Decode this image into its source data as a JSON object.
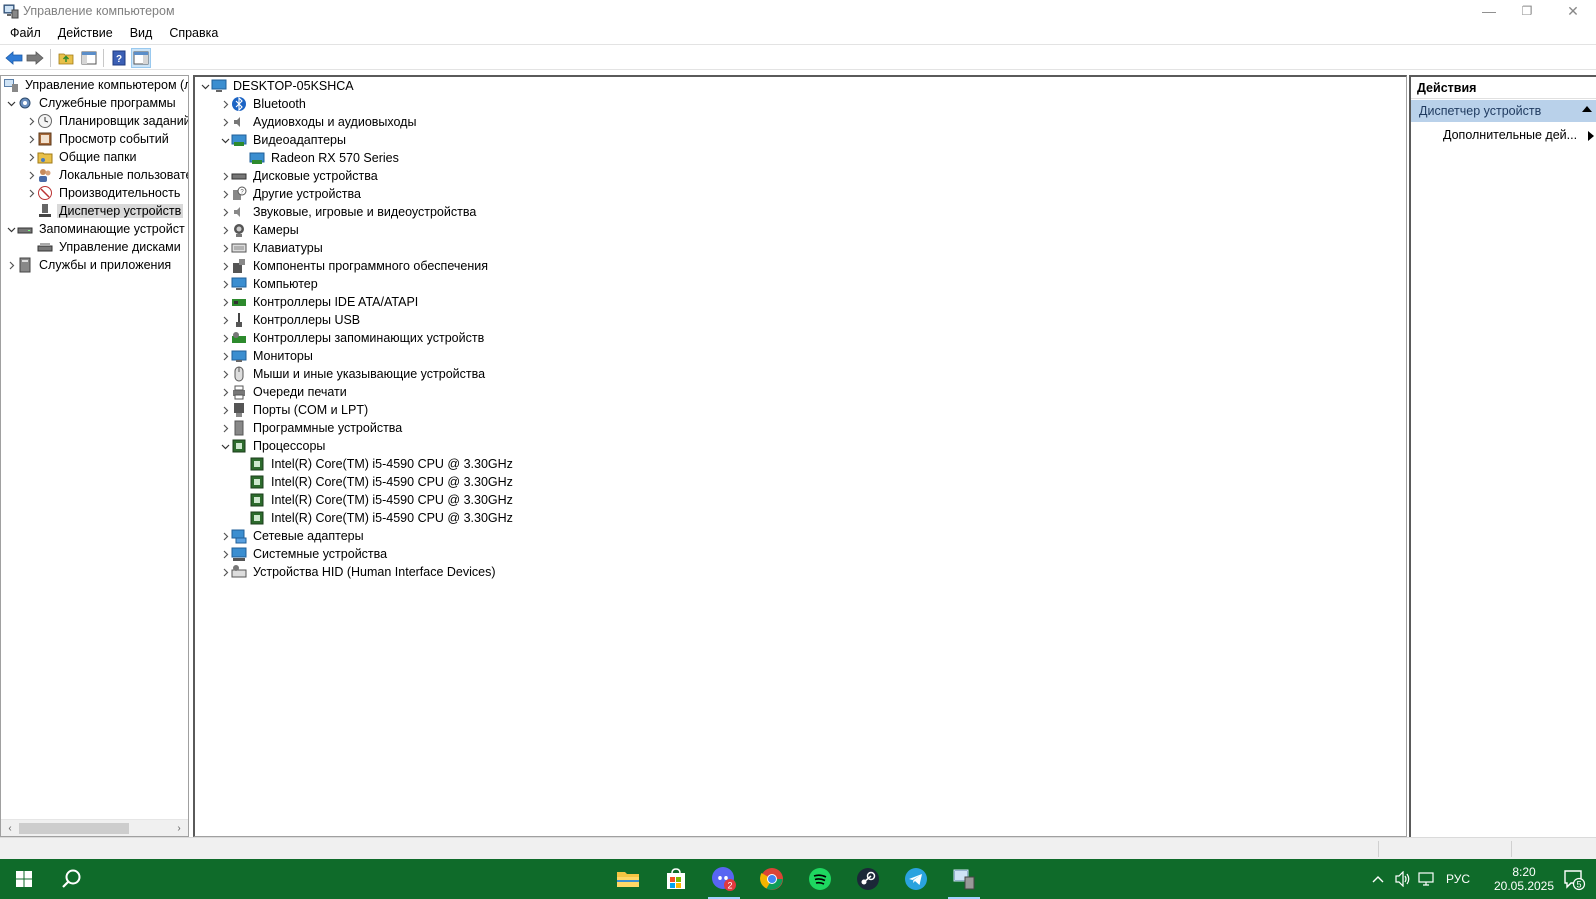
{
  "window": {
    "title": "Управление компьютером",
    "minimize_glyph": "—",
    "restore_glyph": "❐",
    "close_glyph": "✕"
  },
  "menubar": [
    "Файл",
    "Действие",
    "Вид",
    "Справка"
  ],
  "left_tree": {
    "root": "Управление компьютером (л",
    "groups": [
      {
        "label": "Служебные программы",
        "expanded": true,
        "children": [
          {
            "label": "Планировщик заданий",
            "expandable": true
          },
          {
            "label": "Просмотр событий",
            "expandable": true
          },
          {
            "label": "Общие папки",
            "expandable": true
          },
          {
            "label": "Локальные пользовате",
            "expandable": true
          },
          {
            "label": "Производительность",
            "expandable": true
          },
          {
            "label": "Диспетчер устройств",
            "expandable": false,
            "selected": true
          }
        ]
      },
      {
        "label": "Запоминающие устройст",
        "expanded": true,
        "children": [
          {
            "label": "Управление дисками",
            "expandable": false
          }
        ]
      },
      {
        "label": "Службы и приложения",
        "expanded": false,
        "children": []
      }
    ]
  },
  "device_tree": {
    "computer": "DESKTOP-05KSHCA",
    "categories": [
      {
        "label": "Bluetooth",
        "icon": "bluetooth-icon",
        "expanded": false
      },
      {
        "label": "Аудиовходы и аудиовыходы",
        "icon": "speaker-icon",
        "expanded": false
      },
      {
        "label": "Видеоадаптеры",
        "icon": "display-adapter-icon",
        "expanded": true,
        "children": [
          "Radeon RX 570 Series"
        ]
      },
      {
        "label": "Дисковые устройства",
        "icon": "disk-drive-icon",
        "expanded": false
      },
      {
        "label": "Другие устройства",
        "icon": "unknown-device-icon",
        "expanded": false
      },
      {
        "label": "Звуковые, игровые и видеоустройства",
        "icon": "sound-icon",
        "expanded": false
      },
      {
        "label": "Камеры",
        "icon": "camera-icon",
        "expanded": false
      },
      {
        "label": "Клавиатуры",
        "icon": "keyboard-icon",
        "expanded": false
      },
      {
        "label": "Компоненты программного обеспечения",
        "icon": "software-component-icon",
        "expanded": false
      },
      {
        "label": "Компьютер",
        "icon": "computer-icon",
        "expanded": false
      },
      {
        "label": "Контроллеры IDE ATA/ATAPI",
        "icon": "ide-controller-icon",
        "expanded": false
      },
      {
        "label": "Контроллеры USB",
        "icon": "usb-icon",
        "expanded": false
      },
      {
        "label": "Контроллеры запоминающих устройств",
        "icon": "storage-controller-icon",
        "expanded": false
      },
      {
        "label": "Мониторы",
        "icon": "monitor-icon",
        "expanded": false
      },
      {
        "label": "Мыши и иные указывающие устройства",
        "icon": "mouse-icon",
        "expanded": false
      },
      {
        "label": "Очереди печати",
        "icon": "printer-icon",
        "expanded": false
      },
      {
        "label": "Порты (COM и LPT)",
        "icon": "port-icon",
        "expanded": false
      },
      {
        "label": "Программные устройства",
        "icon": "software-device-icon",
        "expanded": false
      },
      {
        "label": "Процессоры",
        "icon": "processor-icon",
        "expanded": true,
        "children": [
          "Intel(R) Core(TM) i5-4590 CPU @ 3.30GHz",
          "Intel(R) Core(TM) i5-4590 CPU @ 3.30GHz",
          "Intel(R) Core(TM) i5-4590 CPU @ 3.30GHz",
          "Intel(R) Core(TM) i5-4590 CPU @ 3.30GHz"
        ]
      },
      {
        "label": "Сетевые адаптеры",
        "icon": "network-adapter-icon",
        "expanded": false
      },
      {
        "label": "Системные устройства",
        "icon": "system-device-icon",
        "expanded": false
      },
      {
        "label": "Устройства HID (Human Interface Devices)",
        "icon": "hid-icon",
        "expanded": false
      }
    ]
  },
  "actions": {
    "header": "Действия",
    "section": "Диспетчер устройств",
    "item": "Дополнительные дей..."
  },
  "taskbar": {
    "discord_badge": "2",
    "tray_language": "РУС",
    "time": "8:20",
    "date": "20.05.2025",
    "notification_count": "5"
  },
  "colors": {
    "taskbar": "#0f6b2a",
    "selection": "#d9d9d9",
    "action_section": "#b9d1ea",
    "accent_blue": "#2f7bd6"
  }
}
